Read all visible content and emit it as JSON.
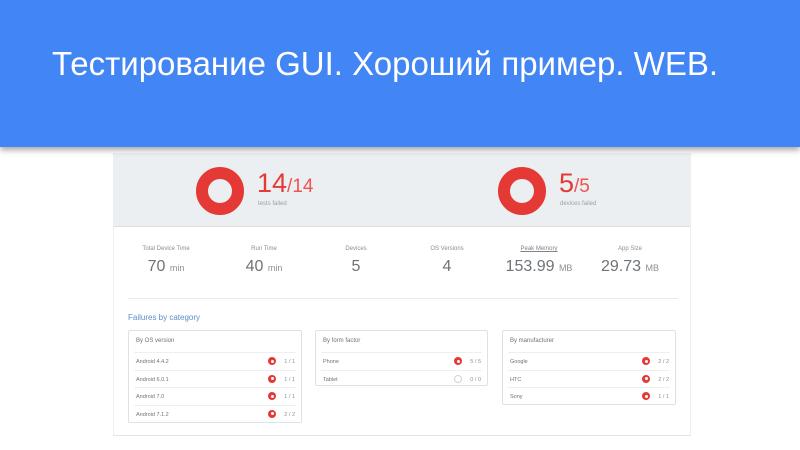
{
  "slide": {
    "title": "Тестирование GUI. Хороший пример. WEB."
  },
  "summary": {
    "tests": {
      "failed": "14",
      "total": "/14",
      "caption": "tests failed"
    },
    "devices": {
      "failed": "5",
      "total": "/5",
      "caption": "devices failed"
    }
  },
  "metrics": [
    {
      "label": "Total Device Time",
      "value": "70",
      "unit": "min"
    },
    {
      "label": "Run Time",
      "value": "40",
      "unit": "min"
    },
    {
      "label": "Devices",
      "value": "5",
      "unit": ""
    },
    {
      "label": "OS Versions",
      "value": "4",
      "unit": ""
    },
    {
      "label": "Peak Memory",
      "value": "153.99",
      "unit": "MB"
    },
    {
      "label": "App Size",
      "value": "29.73",
      "unit": "MB"
    }
  ],
  "failures": {
    "title": "Failures by category",
    "cards": [
      {
        "title": "By OS version",
        "rows": [
          {
            "name": "Android 4.4.2",
            "count": "1 / 1"
          },
          {
            "name": "Android 6.0.1",
            "count": "1 / 1"
          },
          {
            "name": "Android 7.0",
            "count": "1 / 1"
          },
          {
            "name": "Android 7.1.2",
            "count": "2 / 2"
          }
        ]
      },
      {
        "title": "By form factor",
        "rows": [
          {
            "name": "Phone",
            "count": "5 / 5"
          },
          {
            "name": "Tablet",
            "count": "0 / 0"
          }
        ]
      },
      {
        "title": "By manufacturer",
        "rows": [
          {
            "name": "Google",
            "count": "2 / 2"
          },
          {
            "name": "HTC",
            "count": "2 / 2"
          },
          {
            "name": "Sony",
            "count": "1 / 1"
          }
        ]
      }
    ]
  },
  "colors": {
    "header_blue": "#4285f4",
    "fail_red": "#e53935",
    "link_blue": "#5b8fc9"
  }
}
